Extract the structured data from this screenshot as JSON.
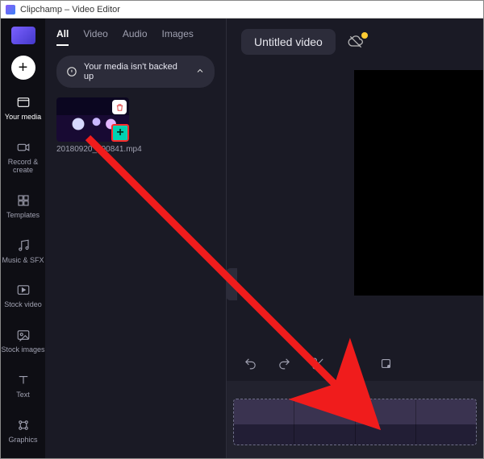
{
  "window": {
    "title": "Clipchamp – Video Editor"
  },
  "header": {
    "project_title": "Untitled video"
  },
  "rail": {
    "items": [
      {
        "id": "your-media",
        "label": "Your media"
      },
      {
        "id": "record-create",
        "label": "Record &\ncreate"
      },
      {
        "id": "templates",
        "label": "Templates"
      },
      {
        "id": "music-sfx",
        "label": "Music & SFX"
      },
      {
        "id": "stock-video",
        "label": "Stock video"
      },
      {
        "id": "stock-images",
        "label": "Stock images"
      },
      {
        "id": "text",
        "label": "Text"
      },
      {
        "id": "graphics",
        "label": "Graphics"
      }
    ]
  },
  "media_panel": {
    "tabs": {
      "all": "All",
      "video": "Video",
      "audio": "Audio",
      "images": "Images"
    },
    "backup_notice": "Your media isn't backed up",
    "clips": [
      {
        "filename": "20180920_190841.mp4"
      }
    ]
  },
  "toolbar": {
    "undo": "undo",
    "redo": "redo",
    "cut": "cut",
    "delete": "delete",
    "crop": "crop"
  }
}
